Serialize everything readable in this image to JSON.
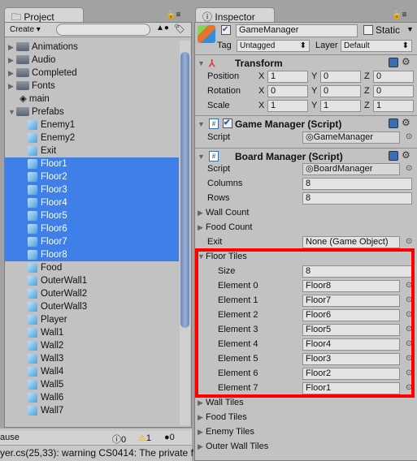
{
  "project": {
    "tab": "Project",
    "create": "Create ▾",
    "search_placeholder": "",
    "items": [
      {
        "label": "Animations",
        "type": "folder",
        "indent": 0,
        "arrow": "▶"
      },
      {
        "label": "Audio",
        "type": "folder",
        "indent": 0,
        "arrow": "▶"
      },
      {
        "label": "Completed",
        "type": "folder",
        "indent": 0,
        "arrow": "▶"
      },
      {
        "label": "Fonts",
        "type": "folder",
        "indent": 0,
        "arrow": "▶"
      },
      {
        "label": "main",
        "type": "unity",
        "indent": 0,
        "arrow": ""
      },
      {
        "label": "Prefabs",
        "type": "folder",
        "indent": 0,
        "arrow": "▼"
      },
      {
        "label": "Enemy1",
        "type": "prefab",
        "indent": 1
      },
      {
        "label": "Enemy2",
        "type": "prefab",
        "indent": 1
      },
      {
        "label": "Exit",
        "type": "prefab",
        "indent": 1
      },
      {
        "label": "Floor1",
        "type": "prefab",
        "indent": 1,
        "selected": true
      },
      {
        "label": "Floor2",
        "type": "prefab",
        "indent": 1,
        "selected": true
      },
      {
        "label": "Floor3",
        "type": "prefab",
        "indent": 1,
        "selected": true
      },
      {
        "label": "Floor4",
        "type": "prefab",
        "indent": 1,
        "selected": true
      },
      {
        "label": "Floor5",
        "type": "prefab",
        "indent": 1,
        "selected": true
      },
      {
        "label": "Floor6",
        "type": "prefab",
        "indent": 1,
        "selected": true
      },
      {
        "label": "Floor7",
        "type": "prefab",
        "indent": 1,
        "selected": true
      },
      {
        "label": "Floor8",
        "type": "prefab",
        "indent": 1,
        "selected": true
      },
      {
        "label": "Food",
        "type": "prefab",
        "indent": 1
      },
      {
        "label": "OuterWall1",
        "type": "prefab",
        "indent": 1
      },
      {
        "label": "OuterWall2",
        "type": "prefab",
        "indent": 1
      },
      {
        "label": "OuterWall3",
        "type": "prefab",
        "indent": 1
      },
      {
        "label": "Player",
        "type": "prefab",
        "indent": 1
      },
      {
        "label": "Wall1",
        "type": "prefab",
        "indent": 1
      },
      {
        "label": "Wall2",
        "type": "prefab",
        "indent": 1
      },
      {
        "label": "Wall3",
        "type": "prefab",
        "indent": 1
      },
      {
        "label": "Wall4",
        "type": "prefab",
        "indent": 1
      },
      {
        "label": "Wall5",
        "type": "prefab",
        "indent": 1
      },
      {
        "label": "Wall6",
        "type": "prefab",
        "indent": 1
      },
      {
        "label": "Wall7",
        "type": "prefab",
        "indent": 1
      }
    ]
  },
  "console": {
    "pause": "ause",
    "info_count": "0",
    "warn_count": "1",
    "error_count": "0",
    "message": "yer.cs(25,33): warning CS0414: The private f"
  },
  "inspector": {
    "tab": "Inspector",
    "object_name": "GameManager",
    "static": "Static",
    "tag_label": "Tag",
    "tag": "Untagged",
    "layer_label": "Layer",
    "layer": "Default",
    "transform": {
      "title": "Transform",
      "rows": [
        {
          "label": "Position",
          "x": "1",
          "y": "0",
          "z": "0"
        },
        {
          "label": "Rotation",
          "x": "0",
          "y": "0",
          "z": "0"
        },
        {
          "label": "Scale",
          "x": "1",
          "y": "1",
          "z": "1"
        }
      ]
    },
    "game_manager": {
      "title": "Game Manager (Script)",
      "script_label": "Script",
      "script": "GameManager"
    },
    "board_manager": {
      "title": "Board Manager (Script)",
      "script_label": "Script",
      "script": "BoardManager",
      "columns_label": "Columns",
      "columns": "8",
      "rows_label": "Rows",
      "rows": "8",
      "wall_count": "Wall Count",
      "food_count": "Food Count",
      "exit_label": "Exit",
      "exit": "None (Game Object)",
      "floor_tiles": "Floor Tiles",
      "size_label": "Size",
      "size": "8",
      "elements": [
        {
          "label": "Element 0",
          "value": "Floor8"
        },
        {
          "label": "Element 1",
          "value": "Floor7"
        },
        {
          "label": "Element 2",
          "value": "Floor6"
        },
        {
          "label": "Element 3",
          "value": "Floor5"
        },
        {
          "label": "Element 4",
          "value": "Floor4"
        },
        {
          "label": "Element 5",
          "value": "Floor3"
        },
        {
          "label": "Element 6",
          "value": "Floor2"
        },
        {
          "label": "Element 7",
          "value": "Floor1"
        }
      ],
      "collapsed": [
        "Wall Tiles",
        "Food Tiles",
        "Enemy Tiles",
        "Outer Wall Tiles"
      ]
    }
  },
  "colors": {
    "selection": "#3e7fe8",
    "highlight": "#ff0000"
  }
}
